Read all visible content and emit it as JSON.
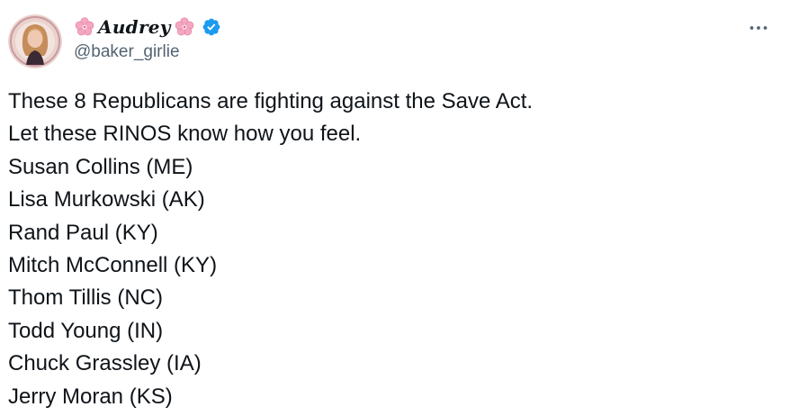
{
  "author": {
    "display_name": "Audrey",
    "handle": "@baker_girlie",
    "verified": true,
    "name_decoration_icon": "cherry-blossom-icon",
    "verified_icon": "verified-badge-icon",
    "avatar_icon": "avatar"
  },
  "menu": {
    "more_icon": "more-options-icon"
  },
  "tweet": {
    "lines": [
      "These 8 Republicans are fighting against the Save Act.",
      "Let these RINOS know how you feel.",
      "Susan Collins (ME)",
      "Lisa Murkowski (AK)",
      "Rand Paul (KY)",
      "Mitch McConnell (KY)",
      "Thom Tillis (NC)",
      "Todd Young (IN)",
      "Chuck Grassley (IA)",
      "Jerry Moran (KS)"
    ]
  },
  "colors": {
    "text_primary": "#0f1419",
    "text_secondary": "#536471",
    "verified_blue": "#1d9bf0",
    "blossom_pink": "#f4a7c0"
  }
}
